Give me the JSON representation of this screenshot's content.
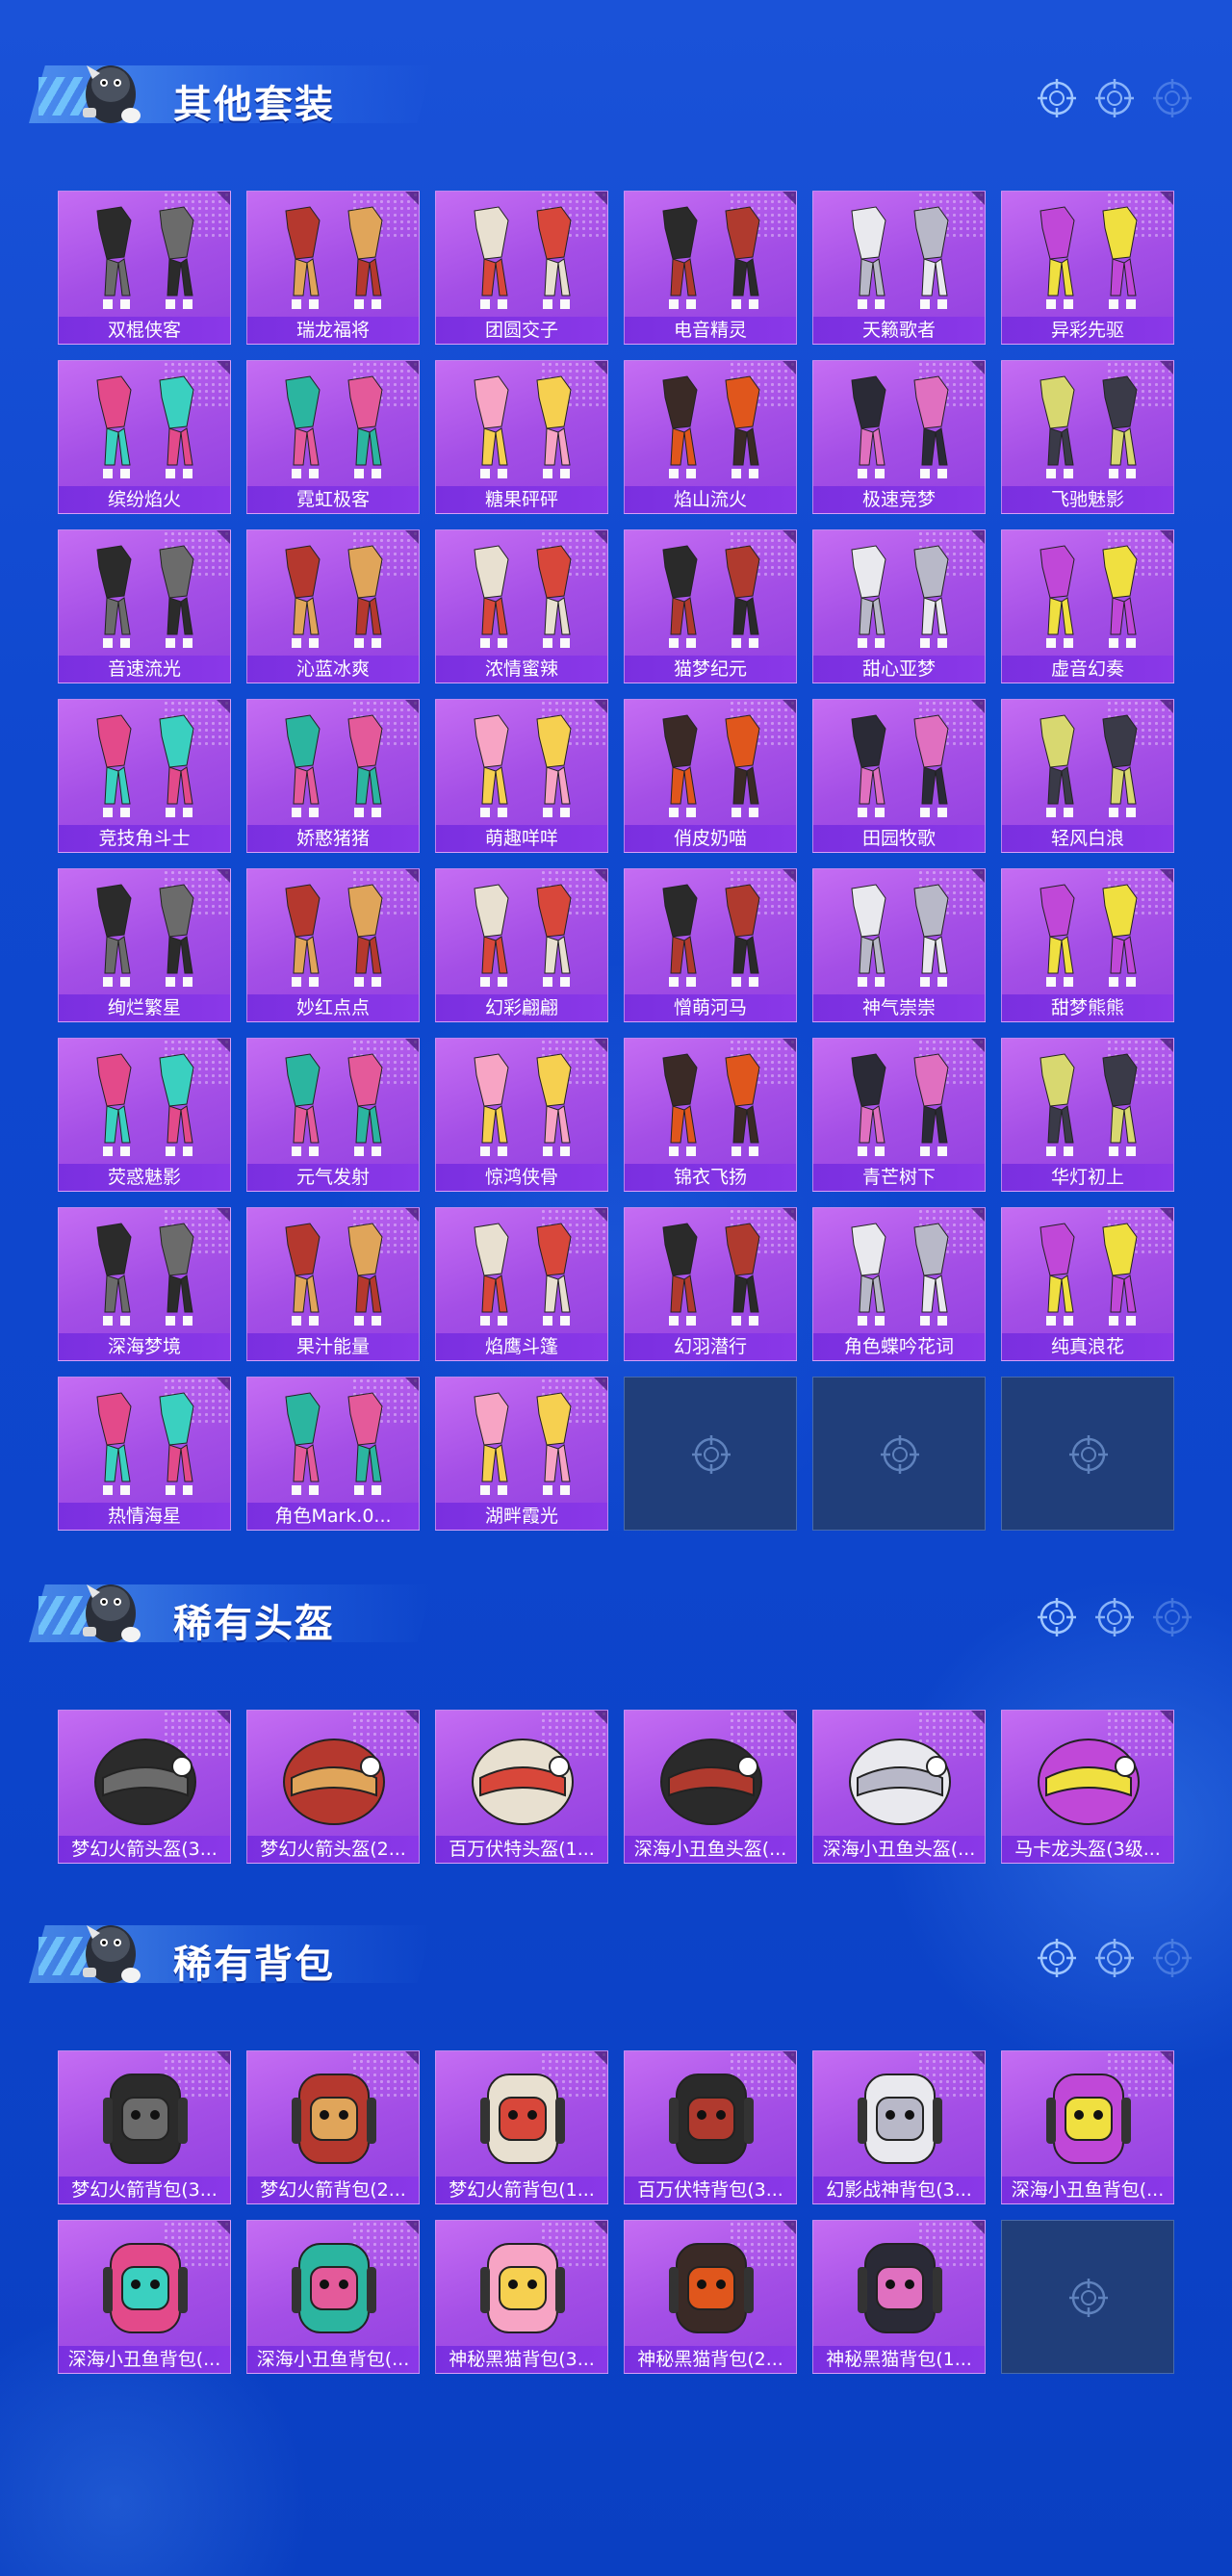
{
  "theme": {
    "card_bg": "#a44fe6",
    "label_bg": "#7a2fe0",
    "page_bg": "#1a52d8",
    "empty_bg": "#203e7a"
  },
  "sections": [
    {
      "id": "suits",
      "title": "其他套装",
      "mascot_icon": "mascot-icon",
      "items": [
        "双棍侠客",
        "瑞龙福将",
        "团圆交子",
        "电音精灵",
        "天籁歌者",
        "异彩先驱",
        "缤纷焰火",
        "霓虹极客",
        "糖果砰砰",
        "焰山流火",
        "极速竞梦",
        "飞驰魅影",
        "音速流光",
        "沁蓝冰爽",
        "浓情蜜辣",
        "猫梦纪元",
        "甜心亚梦",
        "虚音幻奏",
        "竞技角斗士",
        "娇憨猪猪",
        "萌趣咩咩",
        "俏皮奶喵",
        "田园牧歌",
        "轻风白浪",
        "绚烂繁星",
        "妙红点点",
        "幻彩翩翩",
        "憎萌河马",
        "神气崇崇",
        "甜梦熊熊",
        "荧惑魅影",
        "元气发射",
        "惊鸿侠骨",
        "锦衣飞扬",
        "青芒树下",
        "华灯初上",
        "深海梦境",
        "果汁能量",
        "焰鹰斗篷",
        "幻羽潜行",
        "角色蝶吟花词",
        "纯真浪花",
        "热情海星",
        "角色Mark.0...",
        "湖畔霞光"
      ],
      "empty_slots": 3
    },
    {
      "id": "helmets",
      "title": "稀有头盔",
      "mascot_icon": "mascot-icon",
      "items": [
        "梦幻火箭头盔(3...",
        "梦幻火箭头盔(2...",
        "百万伏特头盔(1...",
        "深海小丑鱼头盔(...",
        "深海小丑鱼头盔(...",
        "马卡龙头盔(3级..."
      ],
      "empty_slots": 0
    },
    {
      "id": "backpacks",
      "title": "稀有背包",
      "mascot_icon": "mascot-icon",
      "items": [
        "梦幻火箭背包(3...",
        "梦幻火箭背包(2...",
        "梦幻火箭背包(1...",
        "百万伏特背包(3...",
        "幻影战神背包(3...",
        "深海小丑鱼背包(...",
        "深海小丑鱼背包(...",
        "深海小丑鱼背包(...",
        "神秘黑猫背包(3...",
        "神秘黑猫背包(2...",
        "神秘黑猫背包(1..."
      ],
      "empty_slots": 1
    }
  ]
}
